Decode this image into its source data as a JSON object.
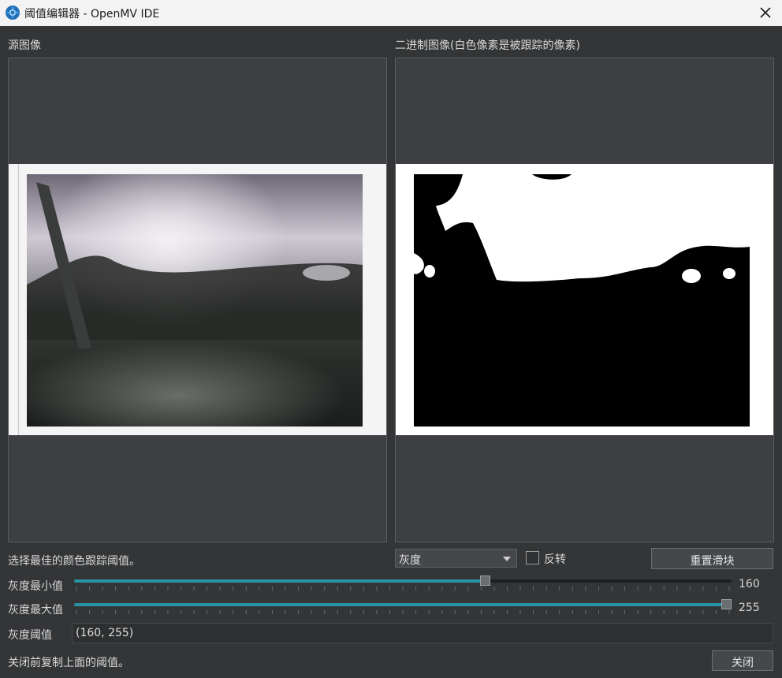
{
  "window": {
    "title": "阈值编辑器 - OpenMV IDE",
    "app_icon": "openmv-logo-icon",
    "close_icon": "close-icon"
  },
  "source_panel": {
    "label": "源图像"
  },
  "binary_panel": {
    "label": "二进制图像(白色像素是被跟踪的像素)"
  },
  "controls": {
    "hint": "选择最佳的颜色跟踪阈值。",
    "mode_select": {
      "value": "灰度",
      "icon": "chevron-down-icon"
    },
    "invert_checkbox": {
      "label": "反转",
      "checked": false
    },
    "reset_button": "重置滑块"
  },
  "sliders": [
    {
      "label": "灰度最小值",
      "value": "160",
      "level": 160,
      "min": 0,
      "max": 255
    },
    {
      "label": "灰度最大值",
      "value": "255",
      "level": 255,
      "min": 0,
      "max": 255
    }
  ],
  "threshold": {
    "label": "灰度阈值",
    "value": "(160, 255)"
  },
  "footer": {
    "note": "关闭前复制上面的阈值。",
    "close_button": "关闭"
  },
  "colors": {
    "accent": "#2a93a3",
    "background": "#333537",
    "panel": "#3d3f42",
    "titlebar": "#f3f3f3"
  }
}
